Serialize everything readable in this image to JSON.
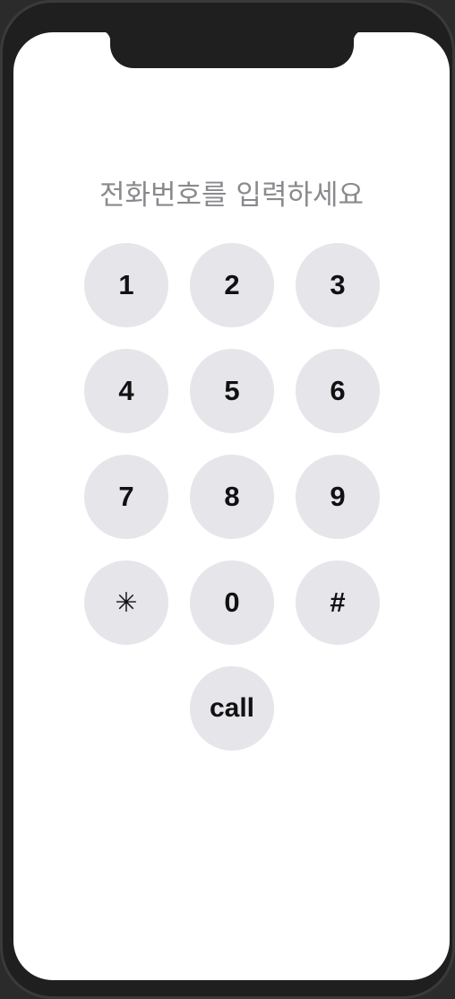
{
  "prompt": "전화번호를 입력하세요",
  "keypad": {
    "k1": "1",
    "k2": "2",
    "k3": "3",
    "k4": "4",
    "k5": "5",
    "k6": "6",
    "k7": "7",
    "k8": "8",
    "k9": "9",
    "star": "✳",
    "k0": "0",
    "hash": "#",
    "call": "call"
  },
  "colors": {
    "key_background": "#e5e5ea",
    "prompt_text": "#8a8a8e",
    "screen_background": "#ffffff",
    "device_frame": "#1f1f1f"
  }
}
